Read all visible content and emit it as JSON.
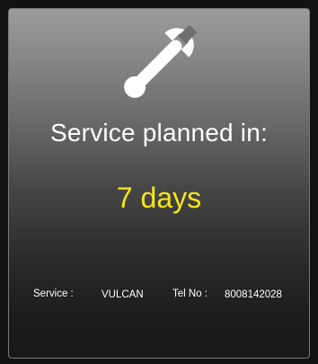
{
  "widget": {
    "icon": "wrench-icon",
    "headline": "Service planned in:",
    "countdown": "7 days",
    "service_label": "Service :",
    "service_value": "VULCAN",
    "tel_label": "Tel No :",
    "tel_value": "8008142028",
    "colors": {
      "headline": "#ffffff",
      "countdown": "#f5e61a",
      "panel_top": "#9c9c9c",
      "panel_bottom": "#181818"
    }
  }
}
